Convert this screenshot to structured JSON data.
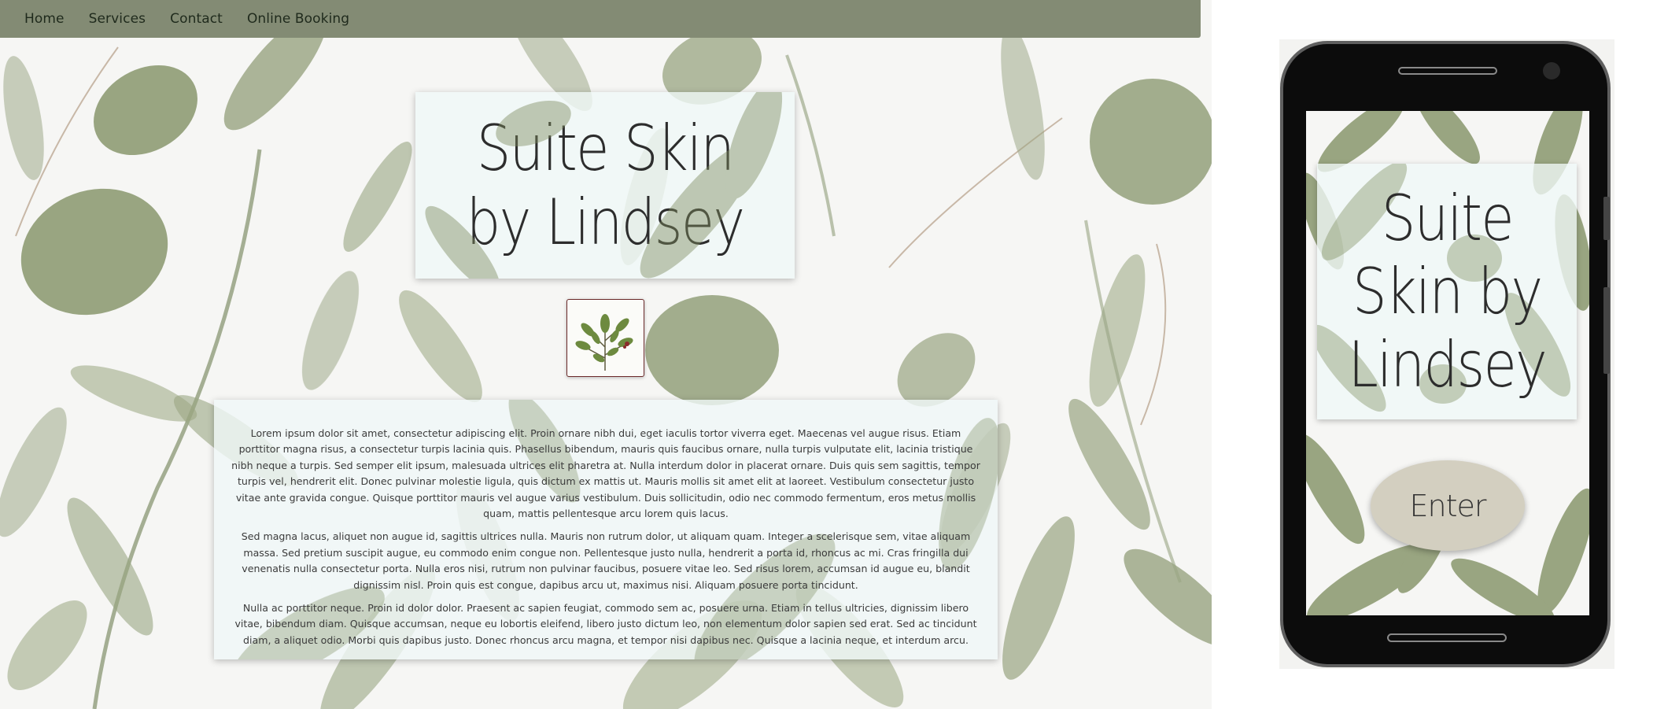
{
  "nav": {
    "items": [
      {
        "label": "Home"
      },
      {
        "label": "Services"
      },
      {
        "label": "Contact"
      },
      {
        "label": "Online Booking"
      }
    ]
  },
  "hero": {
    "title": "Suite Skin by Lindsey"
  },
  "emblem": {
    "icon": "botanical-sprig-icon"
  },
  "content": {
    "paragraphs": [
      "Lorem ipsum dolor sit amet, consectetur adipiscing elit. Proin ornare nibh dui, eget iaculis tortor viverra eget. Maecenas vel augue risus. Etiam porttitor magna risus, a consectetur turpis lacinia quis. Phasellus bibendum, mauris quis faucibus ornare, nulla turpis vulputate elit, lacinia tristique nibh neque a turpis. Sed semper elit ipsum, malesuada ultrices elit pharetra at. Nulla interdum dolor in placerat ornare. Duis quis sem sagittis, tempor turpis vel, hendrerit elit. Donec pulvinar molestie ligula, quis dictum ex mattis ut. Mauris mollis sit amet elit at laoreet. Vestibulum consectetur justo vitae ante gravida congue. Quisque porttitor mauris vel augue varius vestibulum. Duis sollicitudin, odio nec commodo fermentum, eros metus mollis quam, mattis pellentesque arcu lorem quis lacus.",
      "Sed magna lacus, aliquet non augue id, sagittis ultrices nulla. Mauris non rutrum dolor, ut aliquam quam. Integer a scelerisque sem, vitae aliquam massa. Sed pretium suscipit augue, eu commodo enim congue non. Pellentesque justo nulla, hendrerit a porta id, rhoncus ac mi. Cras fringilla dui venenatis nulla consectetur porta. Nulla eros nisi, rutrum non pulvinar faucibus, posuere vitae leo. Sed risus lorem, accumsan id augue eu, blandit dignissim nisl. Proin quis est congue, dapibus arcu ut, maximus nisi. Aliquam posuere porta tincidunt.",
      "Nulla ac porttitor neque. Proin id dolor dolor. Praesent ac sapien feugiat, commodo sem ac, posuere urna. Etiam in tellus ultricies, dignissim libero vitae, bibendum diam. Quisque accumsan, neque eu lobortis eleifend, libero justo dictum leo, non elementum dolor sapien sed erat. Sed ac tincidunt diam, a aliquet odio. Morbi quis dapibus justo. Donec rhoncus arcu magna, et tempor nisi dapibus nec. Quisque a lacinia neque, et interdum arcu."
    ]
  },
  "mobile": {
    "title": "Suite\nSkin by\nLindsey",
    "enter_label": "Enter"
  },
  "colors": {
    "nav_bg": "#838b74",
    "leaf": "#7d8c5e",
    "card_bg": "#f0f8f7",
    "enter_bg": "#d3cfc0"
  }
}
